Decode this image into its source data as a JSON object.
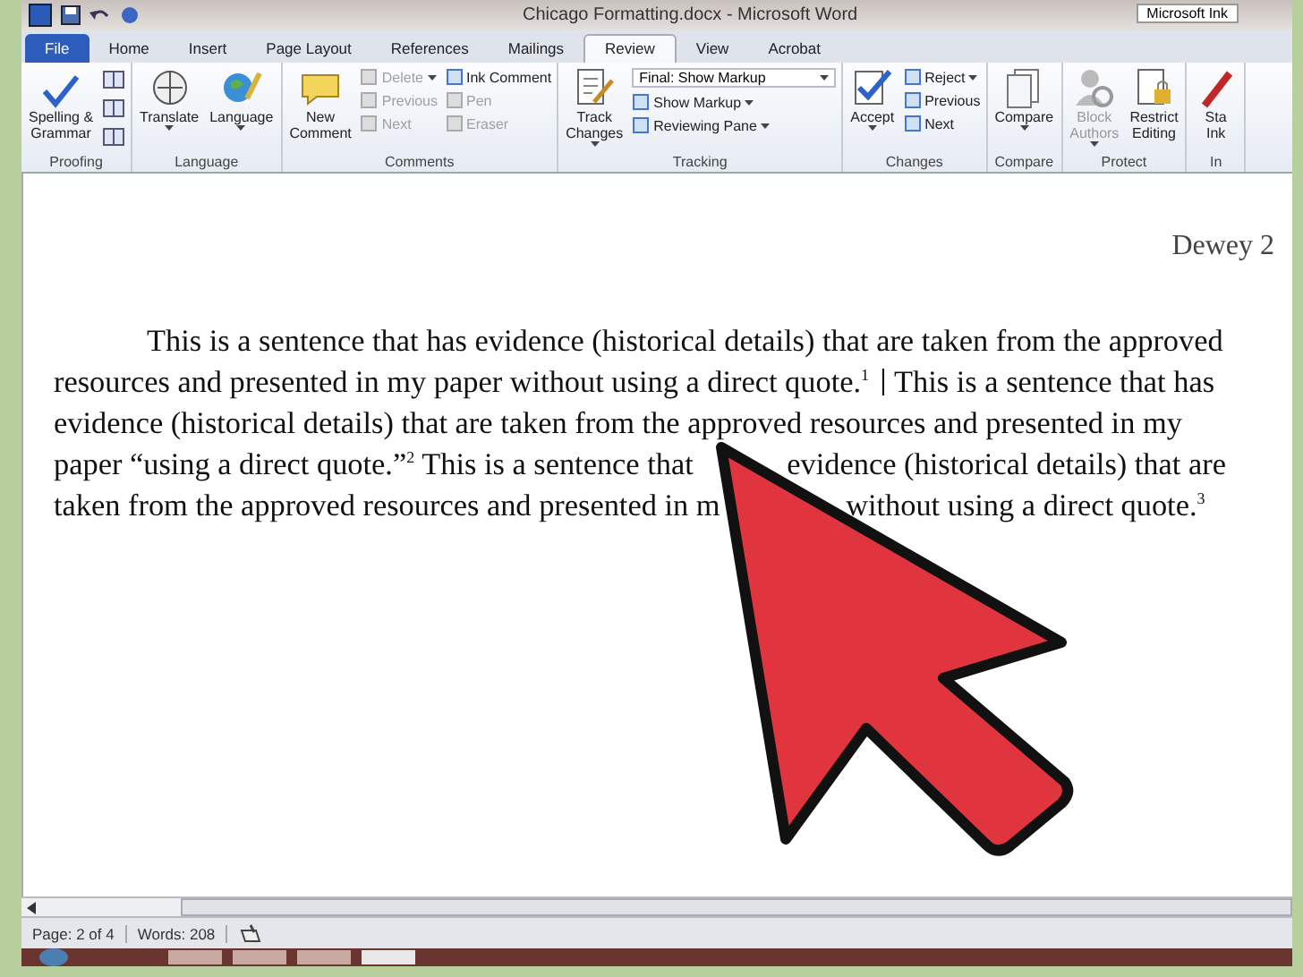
{
  "window": {
    "title": "Chicago Formatting.docx - Microsoft Word",
    "ink_tool": "Microsoft Ink"
  },
  "tabs": [
    {
      "label": "File",
      "selected": false,
      "kind": "file"
    },
    {
      "label": "Home",
      "selected": false,
      "kind": "tab"
    },
    {
      "label": "Insert",
      "selected": false,
      "kind": "tab"
    },
    {
      "label": "Page Layout",
      "selected": false,
      "kind": "tab"
    },
    {
      "label": "References",
      "selected": false,
      "kind": "tab"
    },
    {
      "label": "Mailings",
      "selected": false,
      "kind": "tab"
    },
    {
      "label": "Review",
      "selected": true,
      "kind": "tab"
    },
    {
      "label": "View",
      "selected": false,
      "kind": "tab"
    },
    {
      "label": "Acrobat",
      "selected": false,
      "kind": "tab"
    }
  ],
  "ribbon": [
    {
      "name": "Proofing",
      "columns": [
        {
          "kind": "large",
          "label": "Spelling &\nGrammar",
          "disabled": false,
          "dropdown": false
        },
        {
          "kind": "icons"
        }
      ]
    },
    {
      "name": "Language",
      "columns": [
        {
          "kind": "large",
          "label": "Translate",
          "disabled": false,
          "dropdown": true
        },
        {
          "kind": "large",
          "label": "Language",
          "disabled": false,
          "dropdown": true
        }
      ]
    },
    {
      "name": "Comments",
      "columns": [
        {
          "kind": "large",
          "label": "New\nComment",
          "disabled": false,
          "dropdown": false
        },
        {
          "kind": "stack",
          "items": [
            {
              "label": "Delete",
              "disabled": true,
              "dropdown": true
            },
            {
              "label": "Previous",
              "disabled": true,
              "dropdown": false
            },
            {
              "label": "Next",
              "disabled": true,
              "dropdown": false
            }
          ]
        },
        {
          "kind": "stack",
          "items": [
            {
              "label": "Ink Comment",
              "disabled": false,
              "dropdown": false
            },
            {
              "label": "Pen",
              "disabled": true,
              "dropdown": false
            },
            {
              "label": "Eraser",
              "disabled": true,
              "dropdown": false
            }
          ]
        }
      ]
    },
    {
      "name": "Tracking",
      "columns": [
        {
          "kind": "large",
          "label": "Track\nChanges",
          "disabled": false,
          "dropdown": true
        },
        {
          "kind": "stack",
          "items": [
            {
              "kind": "select",
              "label": "Final: Show Markup",
              "disabled": false,
              "dropdown": true
            },
            {
              "label": "Show Markup",
              "disabled": false,
              "dropdown": true
            },
            {
              "label": "Reviewing Pane",
              "disabled": false,
              "dropdown": true
            }
          ]
        }
      ]
    },
    {
      "name": "Changes",
      "columns": [
        {
          "kind": "large",
          "label": "Accept",
          "disabled": false,
          "dropdown": true
        },
        {
          "kind": "stack",
          "items": [
            {
              "label": "Reject",
              "disabled": false,
              "dropdown": true
            },
            {
              "label": "Previous",
              "disabled": false,
              "dropdown": false
            },
            {
              "label": "Next",
              "disabled": false,
              "dropdown": false
            }
          ]
        }
      ]
    },
    {
      "name": "Compare",
      "columns": [
        {
          "kind": "large",
          "label": "Compare",
          "disabled": false,
          "dropdown": true
        }
      ]
    },
    {
      "name": "Protect",
      "columns": [
        {
          "kind": "large",
          "label": "Block\nAuthors",
          "disabled": true,
          "dropdown": true
        },
        {
          "kind": "large",
          "label": "Restrict\nEditing",
          "disabled": false,
          "dropdown": false
        }
      ]
    },
    {
      "name": "In",
      "columns": [
        {
          "kind": "large",
          "label": "Sta\nInk",
          "disabled": false,
          "dropdown": false
        }
      ]
    }
  ],
  "document": {
    "header": "Dewey 2",
    "lines": [
      {
        "indent": true,
        "segments": [
          "This is a sentence that has evidence (historical details) that are taken from the approved"
        ]
      },
      {
        "indent": false,
        "cursor": true,
        "segments": [
          "resources and presented in my paper without using a direct quote.$^{1}$",
          "This is a sentence that has"
        ]
      },
      {
        "indent": false,
        "segments": [
          "evidence (historical details) that are taken from the approved resources and presented in my"
        ]
      },
      {
        "indent": false,
        "segments": [
          "paper “using a direct quote.”$^{2}$ This is a sentence that",
          "evidence (historical details) that are"
        ]
      },
      {
        "indent": false,
        "segments": [
          "taken from the approved resources and presented in m",
          "without using a direct quote.$^{3}$"
        ]
      }
    ]
  },
  "status_bar": {
    "page": "Page: 2 of 4",
    "words": "Words: 208"
  }
}
